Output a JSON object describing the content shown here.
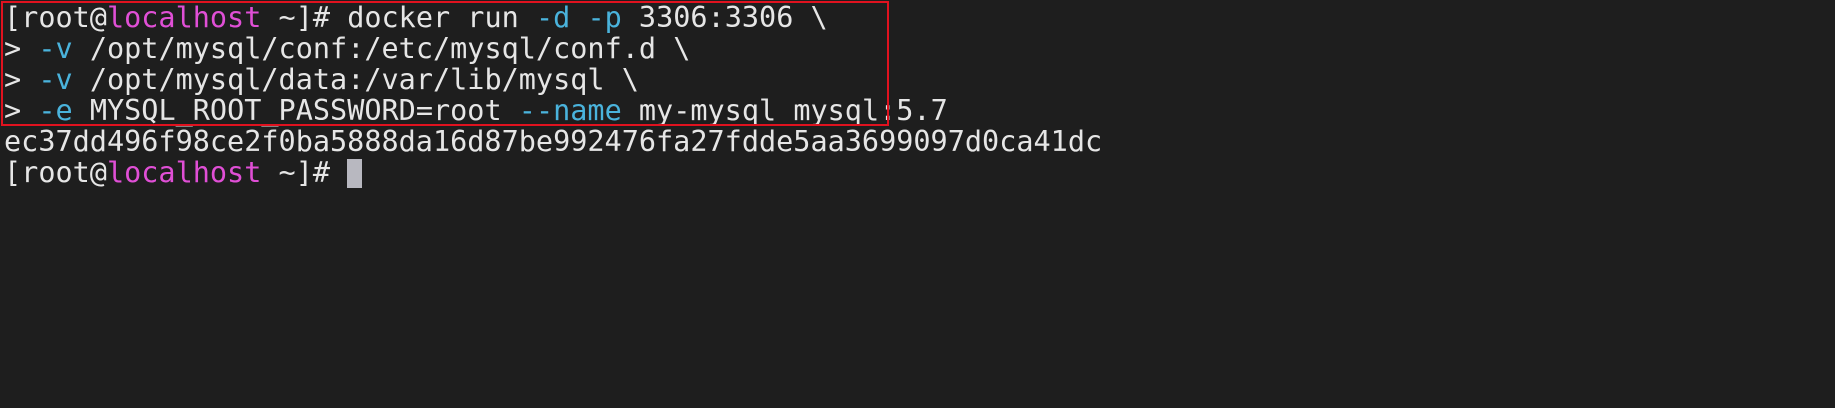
{
  "terminal": {
    "prompt_open": "[root@",
    "prompt_host": "localhost",
    "prompt_close": " ~]# ",
    "continuation": "> ",
    "command": {
      "line1": {
        "cmd": "docker run ",
        "flag_d": "-d",
        "space1": " ",
        "flag_p": "-p",
        "ports": " 3306:3306 \\"
      },
      "line2": {
        "flag": "-v",
        "arg": " /opt/mysql/conf:/etc/mysql/conf.d \\"
      },
      "line3": {
        "flag": "-v",
        "arg": " /opt/mysql/data:/var/lib/mysql \\"
      },
      "line4": {
        "flag_e": "-e",
        "env": " MYSQL_ROOT_PASSWORD=root ",
        "flag_name": "--name",
        "rest": " my-mysql mysql:5.7"
      }
    },
    "output_hash": "ec37dd496f98ce2f0ba5888da16d87be992476fa27fdde5aa3699097d0ca41dc"
  },
  "colors": {
    "background": "#1e1e1e",
    "text": "#e6e6e6",
    "hostname": "#e04fd6",
    "flag": "#4ab3dc",
    "highlight_border": "#e0121f",
    "cursor": "#b8b8c0"
  }
}
